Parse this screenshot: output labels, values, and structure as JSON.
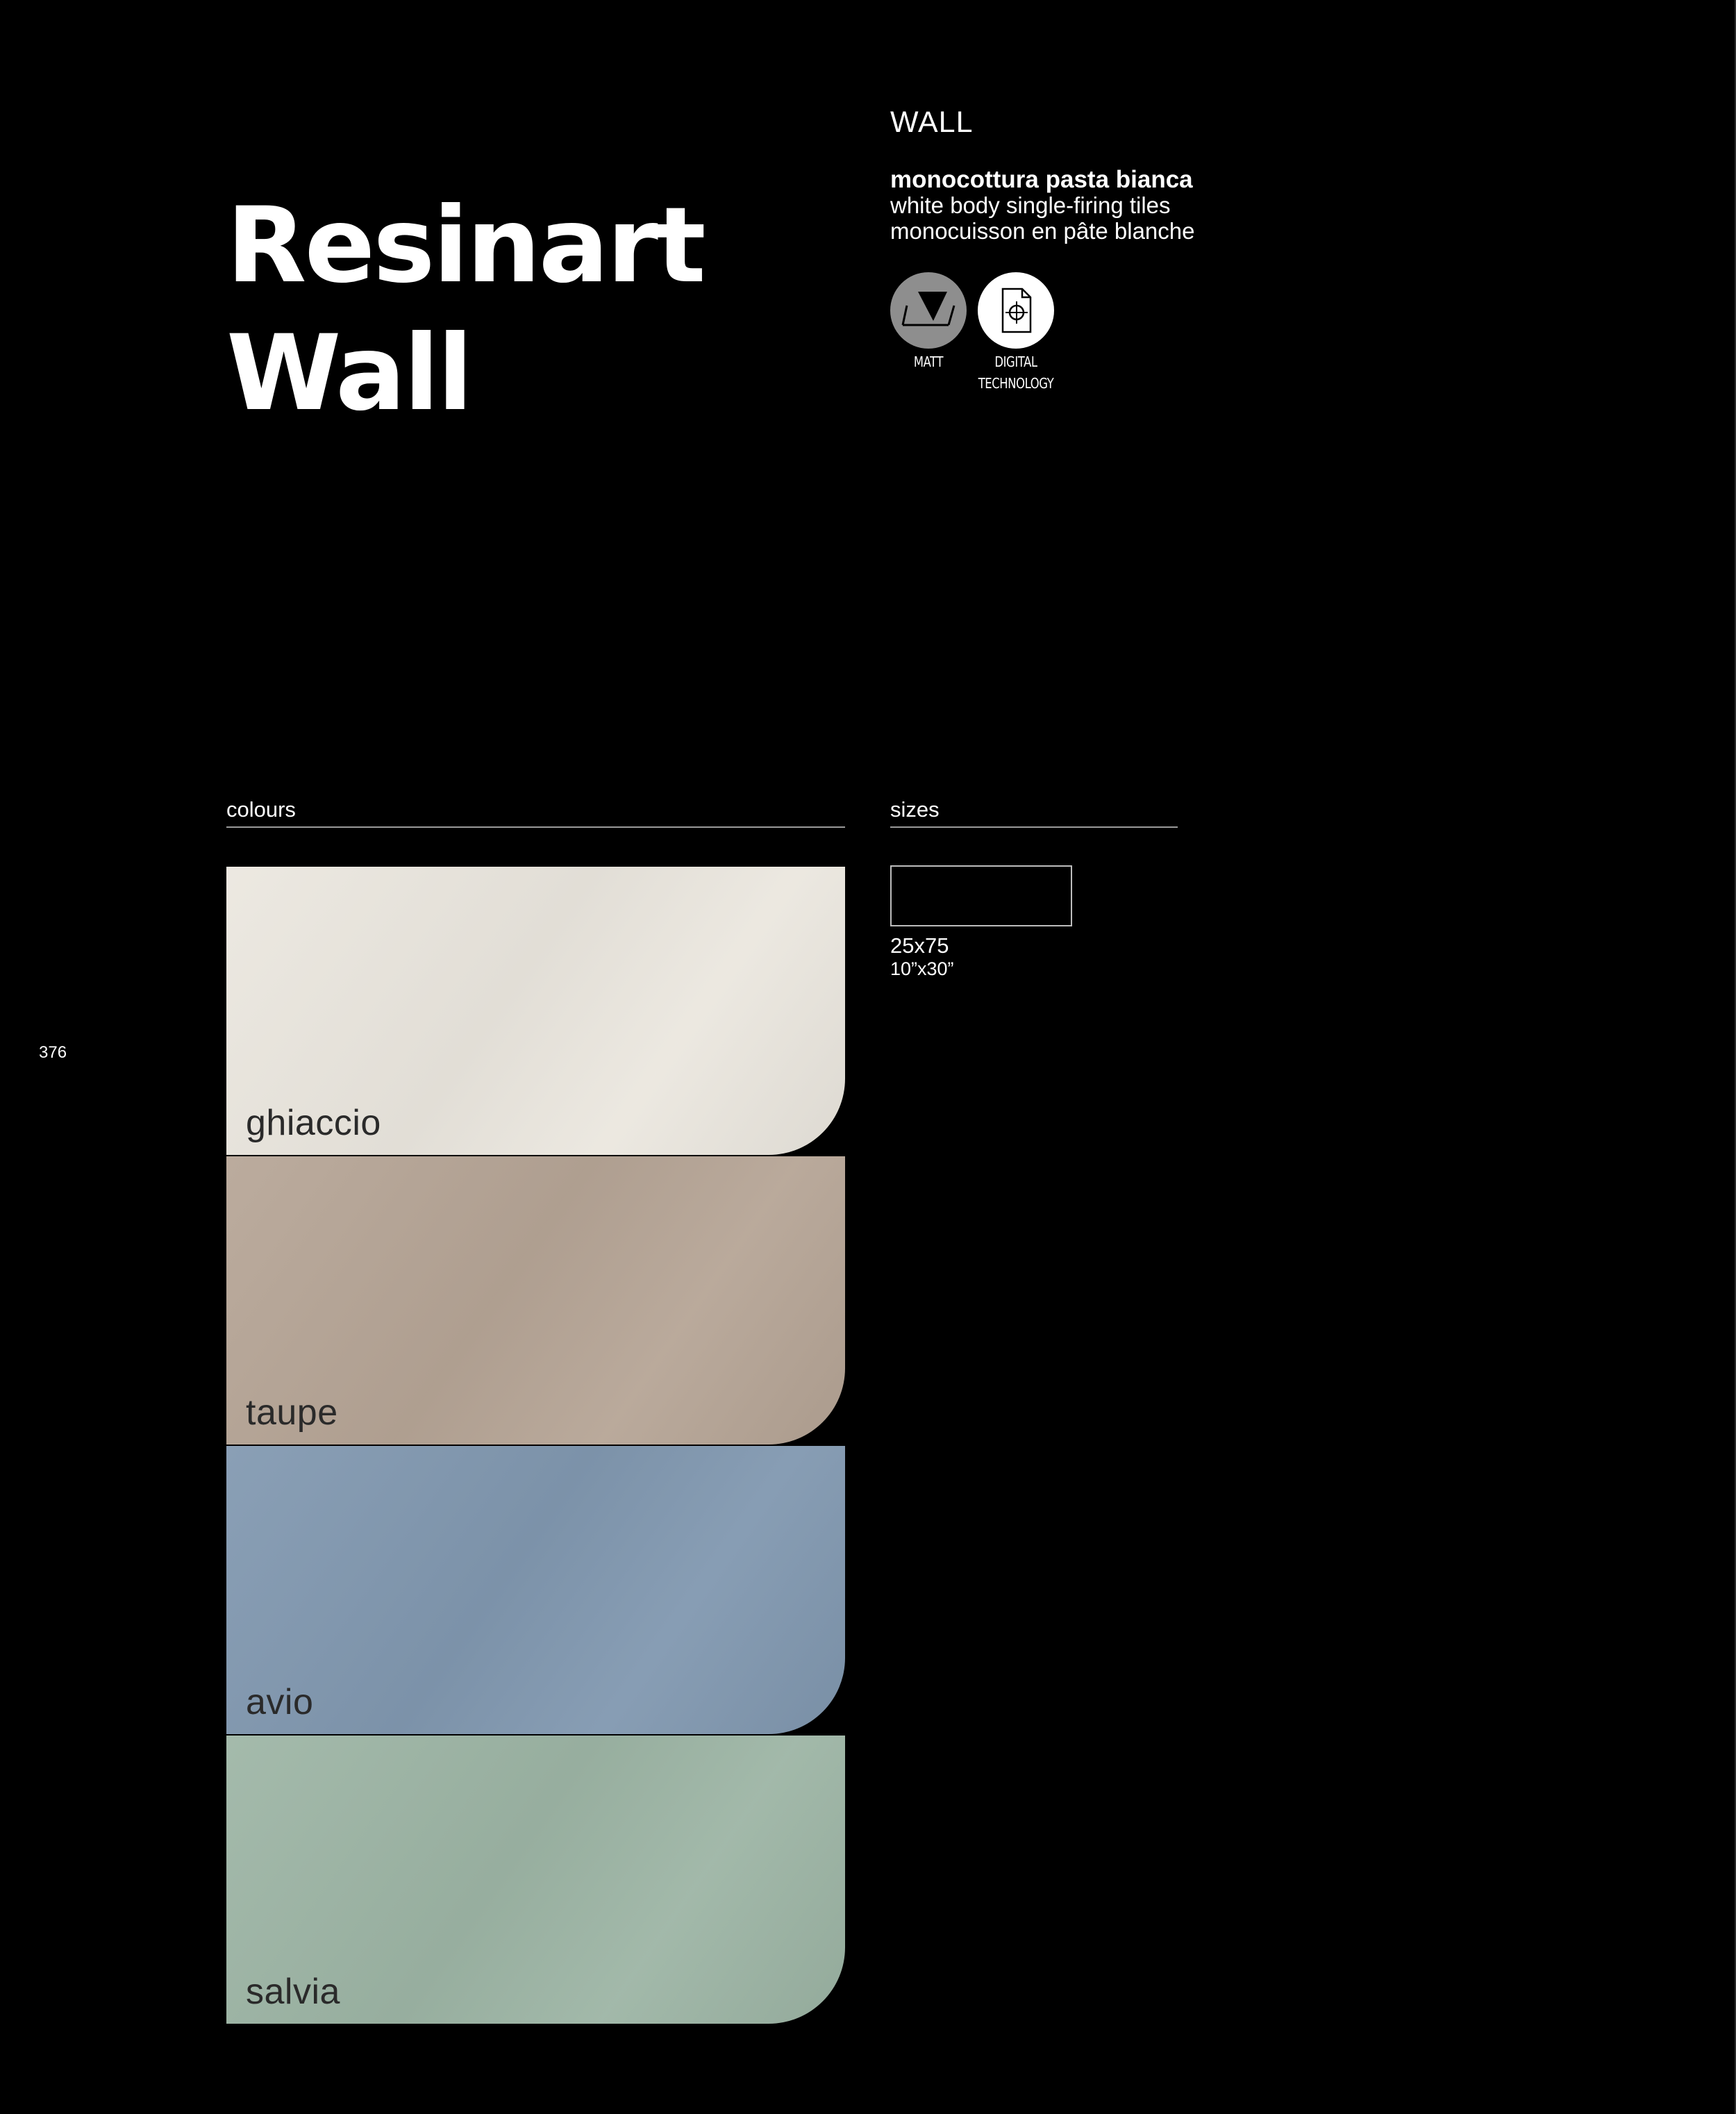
{
  "title": {
    "line1": "Resinart",
    "line2": "Wall"
  },
  "section_tag": "WALL",
  "description": {
    "it": "monocottura pasta bianca",
    "en": "white body single-firing tiles",
    "fr": "monocuisson en pâte blanche"
  },
  "badges": [
    {
      "icon": "matt-icon",
      "label": "MATT"
    },
    {
      "icon": "digital-technology-icon",
      "label_line1": "DIGITAL",
      "label_line2": "TECHNOLOGY"
    }
  ],
  "colours": {
    "heading": "colours",
    "items": [
      {
        "name": "ghiaccio",
        "color": "#ebe7df"
      },
      {
        "name": "taupe",
        "color": "#b6a596"
      },
      {
        "name": "avio",
        "color": "#8198b0"
      },
      {
        "name": "salvia",
        "color": "#9db5a5"
      }
    ]
  },
  "sizes": {
    "heading": "sizes",
    "items": [
      {
        "metric": "25x75",
        "imperial": "10”x30”"
      }
    ]
  },
  "page_number": "376"
}
